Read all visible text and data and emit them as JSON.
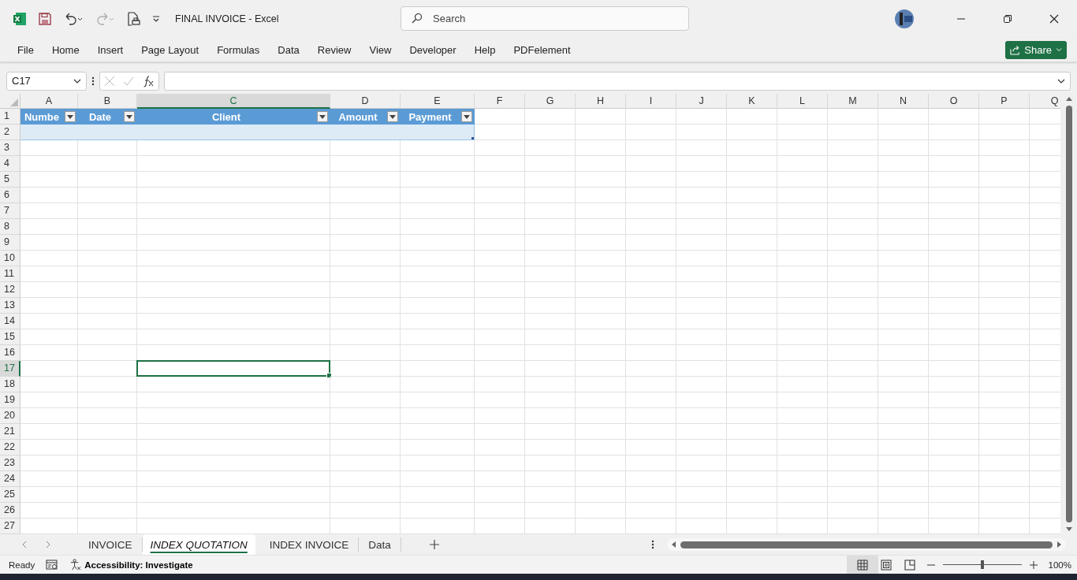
{
  "window": {
    "title": "FINAL INVOICE  -  Excel"
  },
  "search": {
    "placeholder": "Search"
  },
  "menu": [
    {
      "label": "File"
    },
    {
      "label": "Home"
    },
    {
      "label": "Insert"
    },
    {
      "label": "Page Layout"
    },
    {
      "label": "Formulas"
    },
    {
      "label": "Data"
    },
    {
      "label": "Review"
    },
    {
      "label": "View"
    },
    {
      "label": "Developer"
    },
    {
      "label": "Help"
    },
    {
      "label": "PDFelement"
    }
  ],
  "share_button": {
    "label": "Share"
  },
  "name_box": {
    "value": "C17"
  },
  "columns": [
    {
      "letter": "A",
      "selected": false
    },
    {
      "letter": "B",
      "selected": false
    },
    {
      "letter": "C",
      "selected": true
    },
    {
      "letter": "D",
      "selected": false
    },
    {
      "letter": "E",
      "selected": false
    },
    {
      "letter": "F",
      "selected": false
    },
    {
      "letter": "G",
      "selected": false
    },
    {
      "letter": "H",
      "selected": false
    },
    {
      "letter": "I",
      "selected": false
    },
    {
      "letter": "J",
      "selected": false
    },
    {
      "letter": "K",
      "selected": false
    },
    {
      "letter": "L",
      "selected": false
    },
    {
      "letter": "M",
      "selected": false
    },
    {
      "letter": "N",
      "selected": false
    },
    {
      "letter": "O",
      "selected": false
    },
    {
      "letter": "P",
      "selected": false
    },
    {
      "letter": "Q",
      "selected": false
    }
  ],
  "rows": [
    {
      "number": "1",
      "selected": false
    },
    {
      "number": "2",
      "selected": false
    },
    {
      "number": "3",
      "selected": false
    },
    {
      "number": "4",
      "selected": false
    },
    {
      "number": "5",
      "selected": false
    },
    {
      "number": "6",
      "selected": false
    },
    {
      "number": "7",
      "selected": false
    },
    {
      "number": "8",
      "selected": false
    },
    {
      "number": "9",
      "selected": false
    },
    {
      "number": "10",
      "selected": false
    },
    {
      "number": "11",
      "selected": false
    },
    {
      "number": "12",
      "selected": false
    },
    {
      "number": "13",
      "selected": false
    },
    {
      "number": "14",
      "selected": false
    },
    {
      "number": "15",
      "selected": false
    },
    {
      "number": "16",
      "selected": false
    },
    {
      "number": "17",
      "selected": true
    },
    {
      "number": "18",
      "selected": false
    },
    {
      "number": "19",
      "selected": false
    },
    {
      "number": "20",
      "selected": false
    },
    {
      "number": "21",
      "selected": false
    },
    {
      "number": "22",
      "selected": false
    },
    {
      "number": "23",
      "selected": false
    },
    {
      "number": "24",
      "selected": false
    },
    {
      "number": "25",
      "selected": false
    },
    {
      "number": "26",
      "selected": false
    },
    {
      "number": "27",
      "selected": false
    }
  ],
  "table": {
    "headers": [
      "Numbe",
      "Date",
      "Client",
      "Amount",
      "Payment"
    ]
  },
  "sheets": [
    {
      "name": "INVOICE",
      "selected": false
    },
    {
      "name": "INDEX QUOTATION",
      "selected": true
    },
    {
      "name": "INDEX INVOICE",
      "selected": false
    },
    {
      "name": "Data",
      "selected": false
    }
  ],
  "status": {
    "mode": "Ready",
    "accessibility": "Accessibility: Investigate",
    "zoom": {
      "level": 0.5,
      "reading": "100%"
    }
  }
}
